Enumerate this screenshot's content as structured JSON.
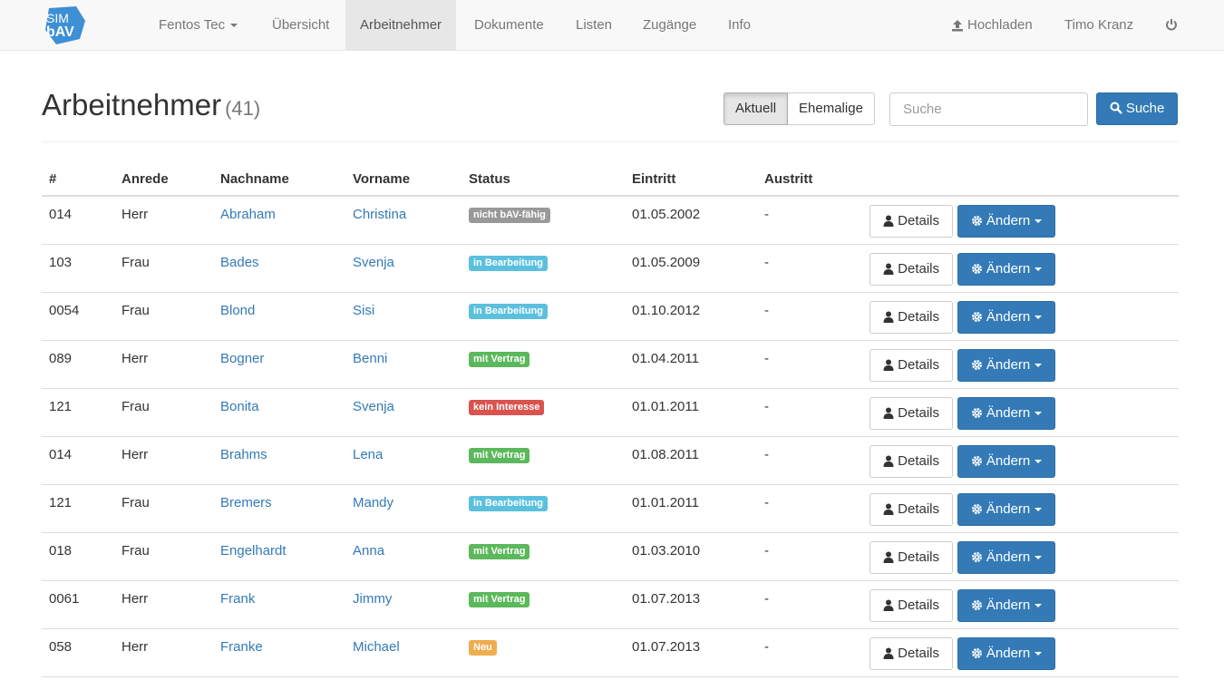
{
  "app": {
    "logo_text_top": "SIM",
    "logo_text_bottom": "bAV"
  },
  "nav": {
    "company": "Fentos Tec",
    "items": [
      "Übersicht",
      "Arbeitnehmer",
      "Dokumente",
      "Listen",
      "Zugänge",
      "Info"
    ],
    "active": "Arbeitnehmer",
    "upload": "Hochladen",
    "user": "Timo Kranz"
  },
  "header": {
    "title": "Arbeitnehmer",
    "count": "(41)",
    "filter_current": "Aktuell",
    "filter_former": "Ehemalige",
    "search_placeholder": "Suche",
    "search_button": "Suche"
  },
  "table": {
    "columns": [
      "#",
      "Anrede",
      "Nachname",
      "Vorname",
      "Status",
      "Eintritt",
      "Austritt"
    ],
    "details_label": "Details",
    "edit_label": "Ändern",
    "rows": [
      {
        "num": "014",
        "anrede": "Herr",
        "nachname": "Abraham",
        "vorname": "Christina",
        "status": "nicht bAV-fähig",
        "eintritt": "01.05.2002",
        "austritt": "-"
      },
      {
        "num": "103",
        "anrede": "Frau",
        "nachname": "Bades",
        "vorname": "Svenja",
        "status": "in Bearbeitung",
        "eintritt": "01.05.2009",
        "austritt": "-"
      },
      {
        "num": "0054",
        "anrede": "Frau",
        "nachname": "Blond",
        "vorname": "Sisi",
        "status": "in Bearbeitung",
        "eintritt": "01.10.2012",
        "austritt": "-"
      },
      {
        "num": "089",
        "anrede": "Herr",
        "nachname": "Bogner",
        "vorname": "Benni",
        "status": "mit Vertrag",
        "eintritt": "01.04.2011",
        "austritt": "-"
      },
      {
        "num": "121",
        "anrede": "Frau",
        "nachname": "Bonita",
        "vorname": "Svenja",
        "status": "kein Interesse",
        "eintritt": "01.01.2011",
        "austritt": "-"
      },
      {
        "num": "014",
        "anrede": "Herr",
        "nachname": "Brahms",
        "vorname": "Lena",
        "status": "mit Vertrag",
        "eintritt": "01.08.2011",
        "austritt": "-"
      },
      {
        "num": "121",
        "anrede": "Frau",
        "nachname": "Bremers",
        "vorname": "Mandy",
        "status": "in Bearbeitung",
        "eintritt": "01.01.2011",
        "austritt": "-"
      },
      {
        "num": "018",
        "anrede": "Frau",
        "nachname": "Engelhardt",
        "vorname": "Anna",
        "status": "mit Vertrag",
        "eintritt": "01.03.2010",
        "austritt": "-"
      },
      {
        "num": "0061",
        "anrede": "Herr",
        "nachname": "Frank",
        "vorname": "Jimmy",
        "status": "mit Vertrag",
        "eintritt": "01.07.2013",
        "austritt": "-"
      },
      {
        "num": "058",
        "anrede": "Herr",
        "nachname": "Franke",
        "vorname": "Michael",
        "status": "Neu",
        "eintritt": "01.07.2013",
        "austritt": "-"
      }
    ]
  },
  "status_colors": {
    "nicht bAV-fähig": "#999999",
    "in Bearbeitung": "#5bc0de",
    "mit Vertrag": "#5cb85c",
    "kein Interesse": "#d9534f",
    "Neu": "#f0ad4e"
  },
  "colors": {
    "primary": "#337ab7",
    "logo": "#3d8fd6"
  }
}
